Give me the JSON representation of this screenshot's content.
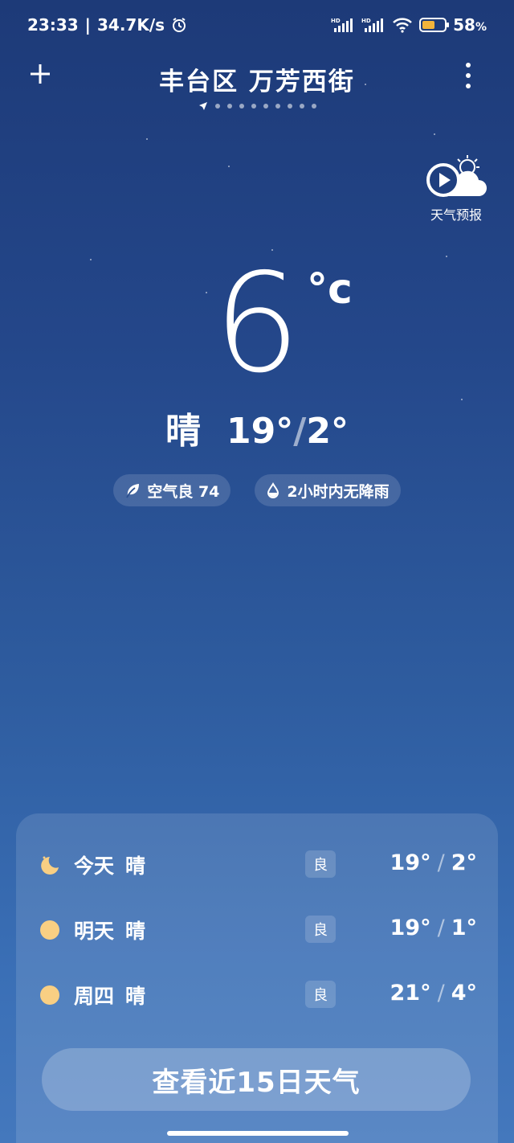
{
  "status_bar": {
    "time": "23:33",
    "separator": "|",
    "net_speed": "34.7K/s",
    "battery_level": 58,
    "battery_percent": "58",
    "percent_sign": "%",
    "icons": [
      "alarm-icon",
      "hd-signal-icon",
      "hd-signal-icon",
      "wifi-icon",
      "battery-icon"
    ]
  },
  "header": {
    "location": "丰台区 万芳西街",
    "page_count": 10,
    "icons": [
      "plus-icon",
      "location-arrow-icon",
      "more-vertical-icon"
    ]
  },
  "forecast_video": {
    "label": "天气预报",
    "icon": "play-cloud-sun-icon"
  },
  "current": {
    "temp": "6",
    "unit": "°c",
    "condition": "晴",
    "high": "19°",
    "separator": "/",
    "low": "2°"
  },
  "pills": {
    "air_quality": "空气良 74",
    "rain": "2小时内无降雨",
    "icons": [
      "leaf-icon",
      "droplet-icon"
    ]
  },
  "forecast": [
    {
      "day": "今天",
      "condition": "晴",
      "aqi": "良",
      "high": "19°",
      "low": "2°",
      "icon": "moon-icon"
    },
    {
      "day": "明天",
      "condition": "晴",
      "aqi": "良",
      "high": "19°",
      "low": "1°",
      "icon": "sun-icon"
    },
    {
      "day": "周四",
      "condition": "晴",
      "aqi": "良",
      "high": "21°",
      "low": "4°",
      "icon": "sun-icon"
    }
  ],
  "forecast_separator": "/",
  "fifteen_day_button": "查看近15日天气",
  "colors": {
    "background_top": "#1d3a78",
    "background_bottom": "#4478bd",
    "sun": "#f9cf83",
    "battery": "#f2b33b"
  }
}
